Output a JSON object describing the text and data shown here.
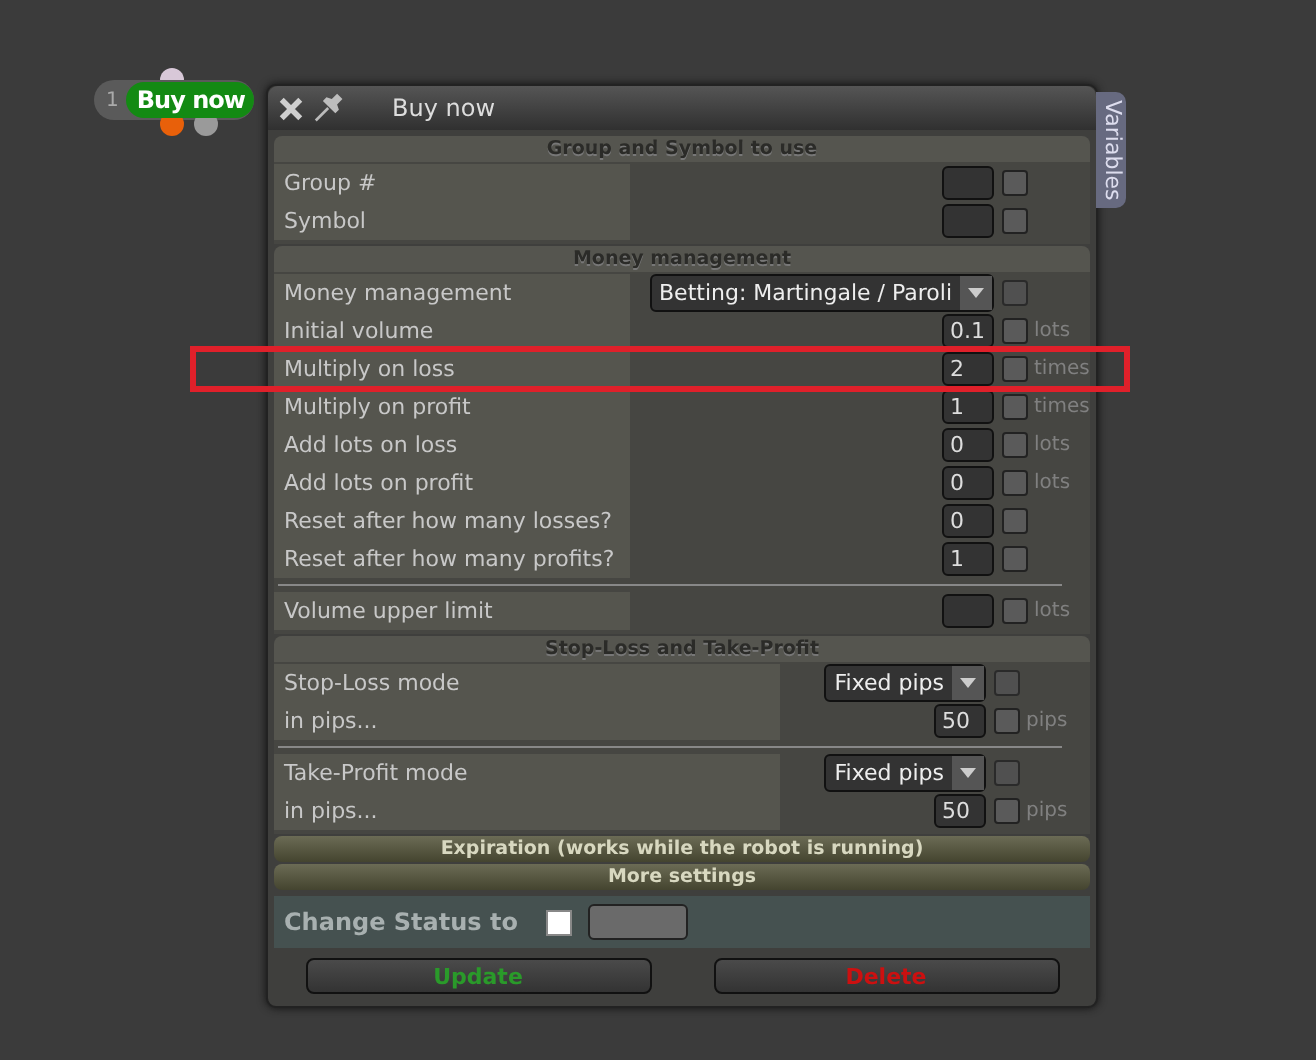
{
  "chip": {
    "number": "1",
    "label": "Buy now"
  },
  "window": {
    "title": "Buy now",
    "side_tab": "Variables"
  },
  "sections": [
    {
      "title": "Group and Symbol to use",
      "kind": "basic",
      "expanded": true,
      "groups": [
        [
          {
            "label": "Group #",
            "kind": "input",
            "checked": false
          },
          {
            "label": "Symbol",
            "kind": "input",
            "checked": false
          }
        ]
      ]
    },
    {
      "title": "Money management",
      "kind": "basic",
      "expanded": true,
      "groups": [
        [
          {
            "label": "Money management",
            "kind": "select",
            "value": "Betting: Martingale / Paroli",
            "checked": false
          },
          {
            "label": "Initial volume",
            "kind": "input",
            "value": "0.1",
            "unit": "lots",
            "checked": false
          },
          {
            "label": "Multiply on loss",
            "kind": "input",
            "value": "2",
            "unit": "times",
            "checked": false,
            "highlighted": true
          },
          {
            "label": "Multiply on profit",
            "kind": "input",
            "value": "1",
            "unit": "times",
            "checked": false
          },
          {
            "label": "Add lots on loss",
            "kind": "input",
            "value": "0",
            "unit": "lots",
            "checked": false
          },
          {
            "label": "Add lots on profit",
            "kind": "input",
            "value": "0",
            "unit": "lots",
            "checked": false
          },
          {
            "label": "Reset after how many losses?",
            "kind": "input",
            "value": "0",
            "checked": false
          },
          {
            "label": "Reset after how many profits?",
            "kind": "input",
            "value": "1",
            "checked": false
          }
        ],
        [
          {
            "label": "Volume upper limit",
            "kind": "input",
            "unit": "lots",
            "checked": false
          }
        ]
      ]
    },
    {
      "title": "Stop-Loss and Take-Profit",
      "kind": "wide",
      "expanded": true,
      "groups": [
        [
          {
            "label": "Stop-Loss mode",
            "kind": "select",
            "value": "Fixed pips",
            "checked": false
          },
          {
            "label": "in pips...",
            "kind": "input",
            "value": "50",
            "unit": "pips",
            "checked": false
          }
        ],
        [
          {
            "label": "Take-Profit mode",
            "kind": "select",
            "value": "Fixed pips",
            "checked": false
          },
          {
            "label": "in pips...",
            "kind": "input",
            "value": "50",
            "unit": "pips",
            "checked": false
          }
        ]
      ]
    },
    {
      "title": "Expiration (works while the robot is running)",
      "expanded": false
    },
    {
      "title": "More settings",
      "expanded": false
    }
  ],
  "status": {
    "label": "Change Status to",
    "checked": false
  },
  "buttons": [
    {
      "label": "Update",
      "kind": "confirm"
    },
    {
      "label": "Delete",
      "kind": "danger"
    }
  ]
}
